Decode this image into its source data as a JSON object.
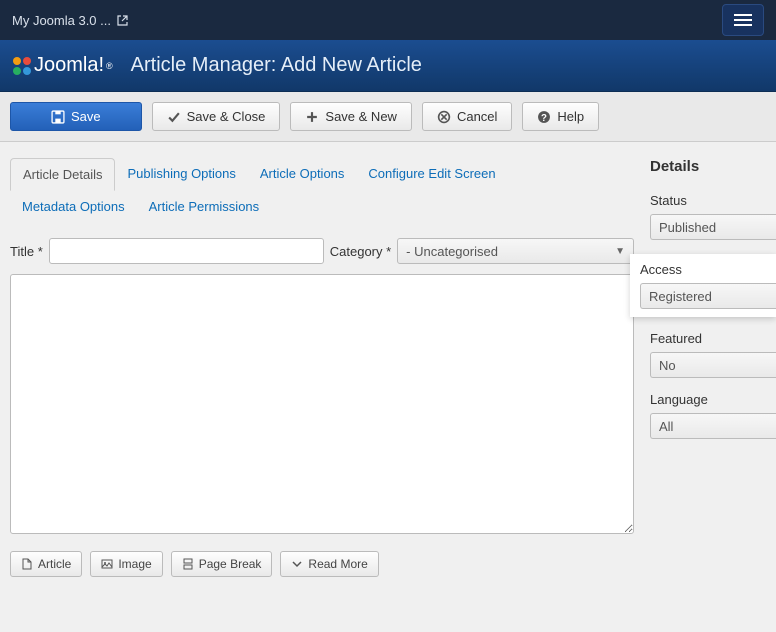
{
  "topbar": {
    "site_name": "My Joomla 3.0 ..."
  },
  "header": {
    "brand": "Joomla!",
    "page_title": "Article Manager: Add New Article"
  },
  "toolbar": {
    "save": "Save",
    "save_close": "Save & Close",
    "save_new": "Save & New",
    "cancel": "Cancel",
    "help": "Help"
  },
  "tabs": [
    "Article Details",
    "Publishing Options",
    "Article Options",
    "Configure Edit Screen",
    "Metadata Options",
    "Article Permissions"
  ],
  "form": {
    "title_label": "Title *",
    "title_value": "",
    "category_label": "Category *",
    "category_value": "- Uncategorised"
  },
  "editor_buttons": {
    "article": "Article",
    "image": "Image",
    "page_break": "Page Break",
    "read_more": "Read More"
  },
  "details": {
    "heading": "Details",
    "status_label": "Status",
    "status_value": "Published",
    "access_label": "Access",
    "access_value": "Registered",
    "featured_label": "Featured",
    "featured_value": "No",
    "language_label": "Language",
    "language_value": "All"
  }
}
